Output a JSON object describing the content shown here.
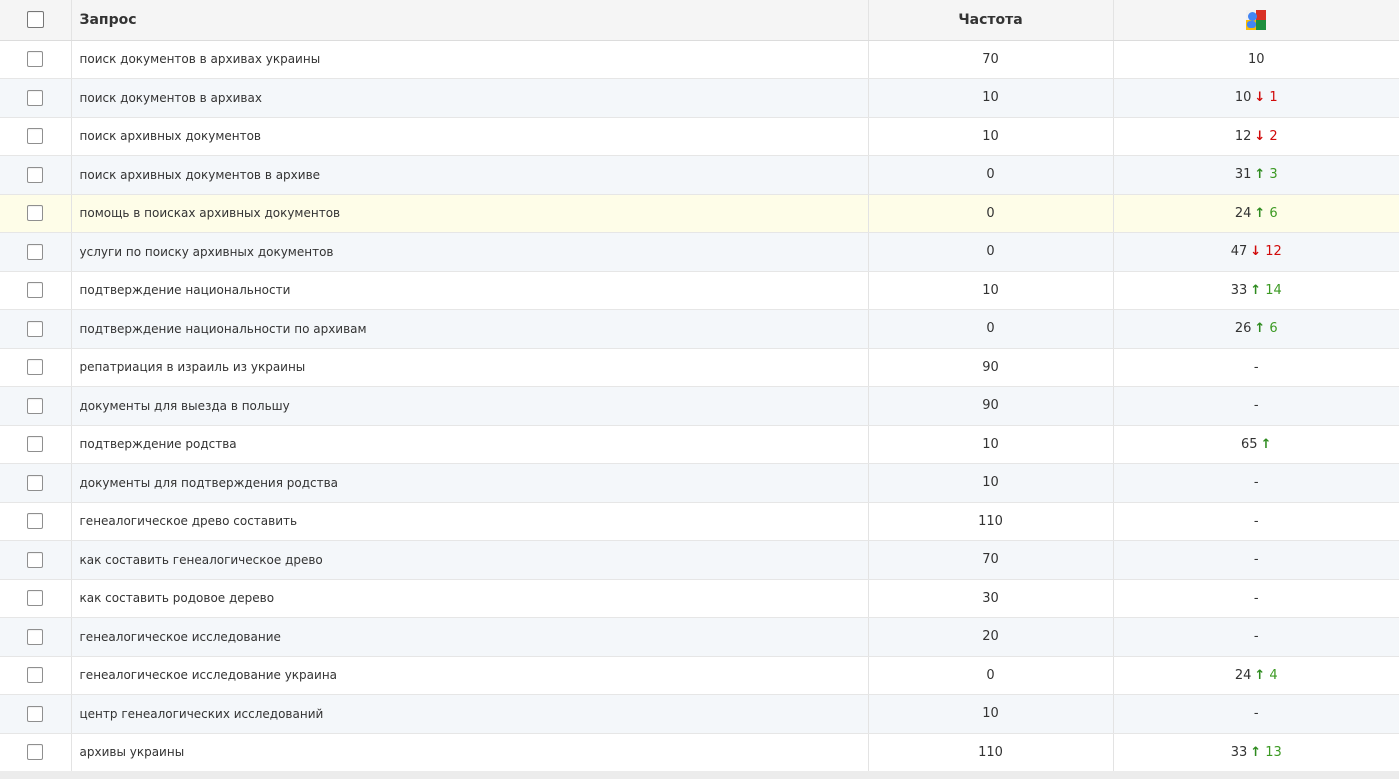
{
  "header": {
    "query_label": "Запрос",
    "freq_label": "Частота",
    "engine_icon": "google-icon"
  },
  "colors": {
    "up": "#2e8b1f",
    "down": "#d10a0a",
    "highlight_row": "#fefde8"
  },
  "rows": [
    {
      "query": "поиск документов в архивах украины",
      "freq": "70",
      "pos": "10",
      "trend": "",
      "change": ""
    },
    {
      "query": "поиск документов в архивах",
      "freq": "10",
      "pos": "10",
      "trend": "down",
      "change": "1"
    },
    {
      "query": "поиск архивных документов",
      "freq": "10",
      "pos": "12",
      "trend": "down",
      "change": "2"
    },
    {
      "query": "поиск архивных документов в архиве",
      "freq": "0",
      "pos": "31",
      "trend": "up",
      "change": "3"
    },
    {
      "query": "помощь в поисках архивных документов",
      "freq": "0",
      "pos": "24",
      "trend": "up",
      "change": "6",
      "highlight": true
    },
    {
      "query": "услуги по поиску архивных документов",
      "freq": "0",
      "pos": "47",
      "trend": "down",
      "change": "12"
    },
    {
      "query": "подтверждение национальности",
      "freq": "10",
      "pos": "33",
      "trend": "up",
      "change": "14"
    },
    {
      "query": "подтверждение национальности по архивам",
      "freq": "0",
      "pos": "26",
      "trend": "up",
      "change": "6"
    },
    {
      "query": "репатриация в израиль из украины",
      "freq": "90",
      "pos": "-",
      "trend": "",
      "change": ""
    },
    {
      "query": "документы для выезда в польшу",
      "freq": "90",
      "pos": "-",
      "trend": "",
      "change": ""
    },
    {
      "query": "подтверждение родства",
      "freq": "10",
      "pos": "65",
      "trend": "up",
      "change": ""
    },
    {
      "query": "документы для подтверждения родства",
      "freq": "10",
      "pos": "-",
      "trend": "",
      "change": ""
    },
    {
      "query": "генеалогическое древо составить",
      "freq": "110",
      "pos": "-",
      "trend": "",
      "change": ""
    },
    {
      "query": "как составить генеалогическое древо",
      "freq": "70",
      "pos": "-",
      "trend": "",
      "change": ""
    },
    {
      "query": "как составить родовое дерево",
      "freq": "30",
      "pos": "-",
      "trend": "",
      "change": ""
    },
    {
      "query": "генеалогическое исследование",
      "freq": "20",
      "pos": "-",
      "trend": "",
      "change": ""
    },
    {
      "query": "генеалогическое исследование украина",
      "freq": "0",
      "pos": "24",
      "trend": "up",
      "change": "4"
    },
    {
      "query": "центр генеалогических исследований",
      "freq": "10",
      "pos": "-",
      "trend": "",
      "change": ""
    },
    {
      "query": "архивы украины",
      "freq": "110",
      "pos": "33",
      "trend": "up",
      "change": "13"
    }
  ]
}
